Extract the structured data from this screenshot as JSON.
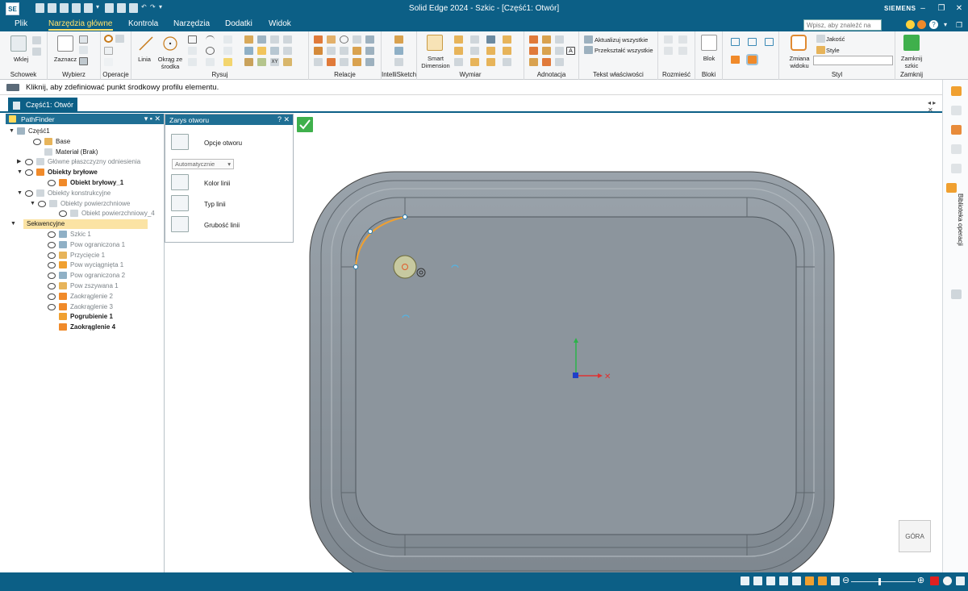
{
  "app": {
    "logo": "SE",
    "title": "Solid Edge 2024 - Szkic - [Część1: Otwór]",
    "brand": "SIEMENS",
    "search_placeholder": "Wpisz, aby znaleźć na"
  },
  "menu": {
    "tabs": [
      "Plik",
      "Narzędzia główne",
      "Kontrola",
      "Narzędzia",
      "Dodatki",
      "Widok"
    ],
    "active": "Narzędzia główne"
  },
  "ribbon": {
    "groups": [
      "Schowek",
      "Wybierz",
      "Operacje",
      "Rysuj",
      "Relacje",
      "IntelliSketch",
      "Wymiar",
      "Adnotacja",
      "Tekst właściwości",
      "Rozmieść",
      "Bloki",
      "Styl",
      "Zamknij"
    ],
    "buttons": {
      "paste": "Wklej",
      "select": "Zaznacz",
      "line": "Linia",
      "circle": "Okrąg ze środka",
      "smart_dimension": "Smart Dimension",
      "update_all": "Aktualizuj wszystkie",
      "convert_all": "Przekształć wszystkie",
      "block": "Blok",
      "change_view": "Zmiana widoku",
      "quality": "Jakość",
      "style": "Style",
      "close_sketch": "Zamknij szkic"
    }
  },
  "prompt": "Kliknij, aby zdefiniować punkt środkowy profilu elementu.",
  "doc_tab": "Część1: Otwór",
  "pathfinder": {
    "title": "PathFinder",
    "items": [
      {
        "label": "Część1",
        "style": "normal"
      },
      {
        "label": "Base",
        "style": "normal"
      },
      {
        "label": "Materiał (Brak)",
        "style": "normal"
      },
      {
        "label": "Główne płaszczyzny odniesienia",
        "style": "gray"
      },
      {
        "label": "Obiekty bryłowe",
        "style": "bold"
      },
      {
        "label": "Obiekt bryłowy_1",
        "style": "bold"
      },
      {
        "label": "Obiekty konstrukcyjne",
        "style": "gray"
      },
      {
        "label": "Obiekty powierzchniowe",
        "style": "gray"
      },
      {
        "label": "Obiekt powierzchniowy_4",
        "style": "gray"
      },
      {
        "label": "Sekwencyjne",
        "style": "normal"
      },
      {
        "label": "Szkic 1",
        "style": "gray"
      },
      {
        "label": "Pow ograniczona 1",
        "style": "gray"
      },
      {
        "label": "Przycięcie 1",
        "style": "gray"
      },
      {
        "label": "Pow wyciągnięta 1",
        "style": "gray"
      },
      {
        "label": "Pow ograniczona 2",
        "style": "gray"
      },
      {
        "label": "Pow zszywana 1",
        "style": "gray"
      },
      {
        "label": "Zaokrąglenie 2",
        "style": "gray"
      },
      {
        "label": "Zaokrąglenie 3",
        "style": "gray"
      },
      {
        "label": "Pogrubienie 1",
        "style": "bold"
      },
      {
        "label": "Zaokrąglenie 4",
        "style": "bold"
      }
    ]
  },
  "hole_panel": {
    "title": "Zarys otworu",
    "options": "Opcje otworu",
    "mode": "Automatycznie",
    "line_color": "Kolor linii",
    "line_type": "Typ linii",
    "line_width": "Grubość linii"
  },
  "right_panel_label": "Biblioteka operacji",
  "nav_cube": "GÓRA",
  "colors": {
    "title_bar": "#0c5f86",
    "part_fill": "#8a949c",
    "sketch_arc": "#f0a030",
    "confirm": "#3fb04c"
  },
  "zoom_level": 0.42
}
